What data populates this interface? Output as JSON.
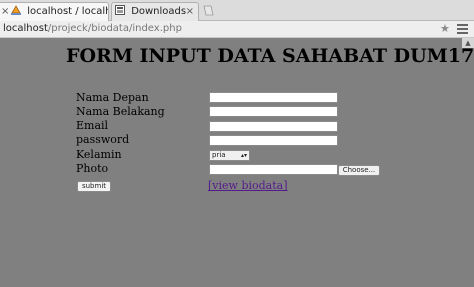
{
  "browser": {
    "tabs": [
      {
        "title": "localhost / localh...",
        "icon": "phpmyadmin-sail-icon"
      },
      {
        "title": "Downloads",
        "icon": "downloads-icon"
      }
    ],
    "close_glyph": "×",
    "url_host": "localhost",
    "url_path": "/projeck/biodata/index.php",
    "star_glyph": "★",
    "scroll_glyph": "▲"
  },
  "page": {
    "title": "FORM INPUT DATA SAHABAT DUM17",
    "form": {
      "labels": {
        "first_name": "Nama Depan",
        "last_name": "Nama Belakang",
        "email": "Email",
        "password": "password",
        "gender": "Kelamin",
        "photo": "Photo"
      },
      "values": {
        "first_name": "",
        "last_name": "",
        "email": "",
        "password": "",
        "photo": ""
      },
      "gender_selected": "pria",
      "select_arrow": "▴▾",
      "choose_label": "Choose...",
      "submit_label": "submit"
    },
    "link_text": "[view biodata]"
  },
  "colors": {
    "page_background": "#808080",
    "visited_link": "#551a8b"
  }
}
